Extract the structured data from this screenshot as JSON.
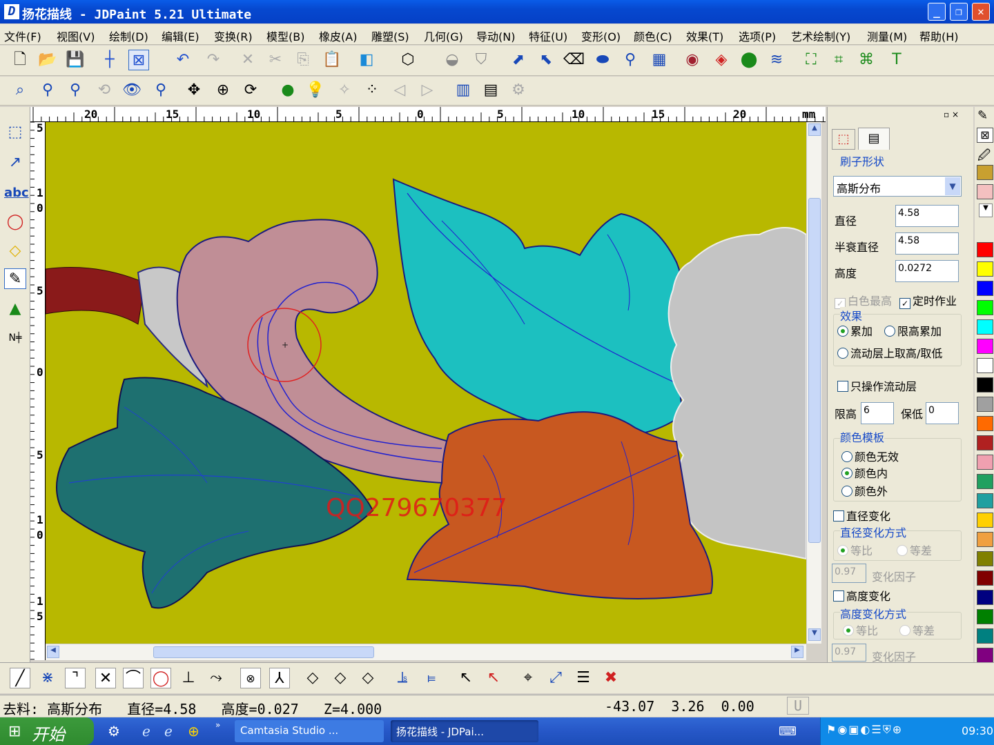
{
  "title": "扬花描线 - JDPaint 5.21 Ultimate",
  "menu": [
    "文件(F)",
    "视图(V)",
    "绘制(D)",
    "编辑(E)",
    "变换(R)",
    "模型(B)",
    "橡皮(A)",
    "雕塑(S)",
    "几何(G)",
    "导动(N)",
    "特征(U)",
    "变形(O)",
    "颜色(C)",
    "效果(T)",
    "选项(P)",
    "艺术绘制(Y)",
    "测量(M)",
    "帮助(H)"
  ],
  "ruler": {
    "top_labels": [
      "20",
      "15",
      "10",
      "5",
      "0",
      "5",
      "10",
      "15",
      "20"
    ],
    "unit": "mm",
    "left_labels": [
      "5",
      "1",
      "0",
      "5",
      "0",
      "5",
      "1",
      "0",
      "1",
      "5"
    ]
  },
  "watermark": "QQ279670377",
  "panel": {
    "section_brush": "刷子形状",
    "brush_shape": "高斯分布",
    "diameter_label": "直径",
    "diameter": "4.58",
    "half_diameter_label": "半衰直径",
    "half_diameter": "4.58",
    "height_label": "高度",
    "height": "0.0272",
    "white_max": "白色最高",
    "timed_op": "定时作业",
    "effect_title": "效果",
    "effect_add": "累加",
    "effect_limit_add": "限高累加",
    "effect_flow": "流动层上取高/取低",
    "only_flow": "只操作流动层",
    "limit_label": "限高",
    "limit": "6",
    "keep_label": "保低",
    "keep": "0",
    "color_template": "颜色模板",
    "color_none": "颜色无效",
    "color_in": "颜色内",
    "color_out": "颜色外",
    "dia_change": "直径变化",
    "dia_change_mode": "直径变化方式",
    "ratio": "等比",
    "diff": "等差",
    "factor": "0.97",
    "factor_label": "变化因子",
    "height_change": "高度变化",
    "height_change_mode": "高度变化方式"
  },
  "status": {
    "text": "去料: 高斯分布   直径=4.58   高度=0.027   Z=4.000",
    "coords": "-43.07  3.26  0.00",
    "flag": "U"
  },
  "taskbar": {
    "start": "开始",
    "tasks": [
      "Camtasia Studio ...",
      "扬花描线 - JDPai..."
    ],
    "time": "09:30"
  },
  "colors": {
    "canvas": "#b8b800",
    "accent": "#0a5ce8"
  }
}
